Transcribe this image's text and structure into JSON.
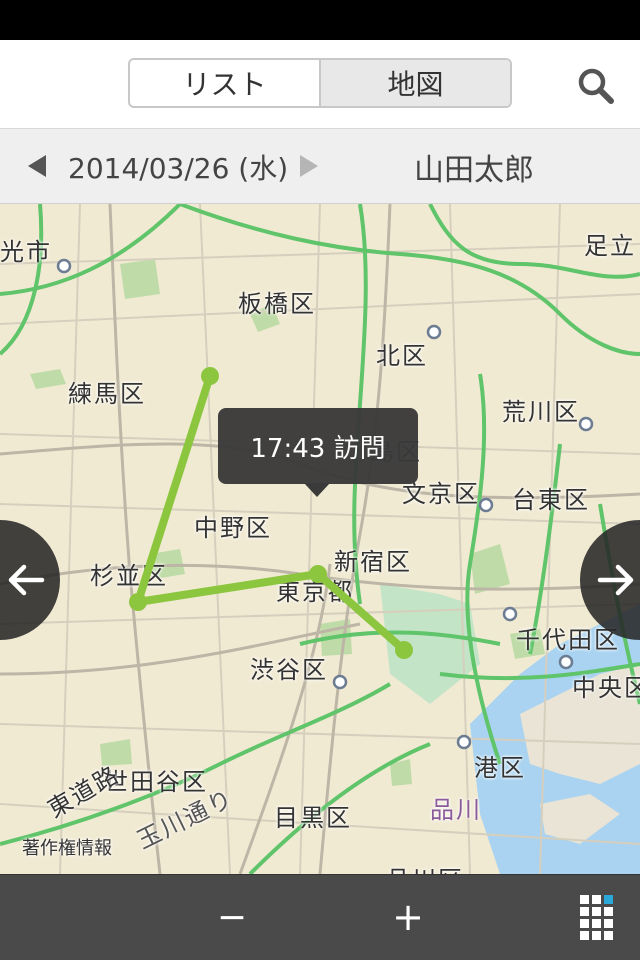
{
  "header": {
    "tabs": [
      {
        "label": "リスト",
        "active": false
      },
      {
        "label": "地図",
        "active": true
      }
    ],
    "search_icon": "search-icon"
  },
  "datebar": {
    "date": "2014/03/26 (水)",
    "user": "山田太郎",
    "prev_icon": "triangle-left-icon",
    "next_icon": "triangle-right-icon"
  },
  "map": {
    "labels": {
      "hikarigaoka": "光市",
      "itabashi": "板橋区",
      "adachi": "足立",
      "kita": "北区",
      "nerima": "練馬区",
      "arakawa": "荒川区",
      "toshima": "島区",
      "bunkyo": "文京区",
      "taito": "台東区",
      "nakano": "中野区",
      "suginami": "杉並区",
      "shinjuku": "新宿区",
      "tokyoto": "東京都",
      "chiyoda": "千代田区",
      "shibuya": "渋谷区",
      "chuo": "中央区",
      "minato": "港区",
      "setagaya": "世田谷区",
      "shinagawa_station": "品川",
      "meguro": "目黒区",
      "shinagawa": "品川区",
      "expressway": "東道路",
      "tamagawa": "玉川通り",
      "copyright": "著作権情報"
    },
    "tooltip": "17:43 訪問",
    "route_color": "#8cc63f"
  },
  "controls": {
    "zoom_out": "−",
    "zoom_in": "+",
    "grid_icon": "grid-menu-icon",
    "accent": "#2aa8d8"
  }
}
